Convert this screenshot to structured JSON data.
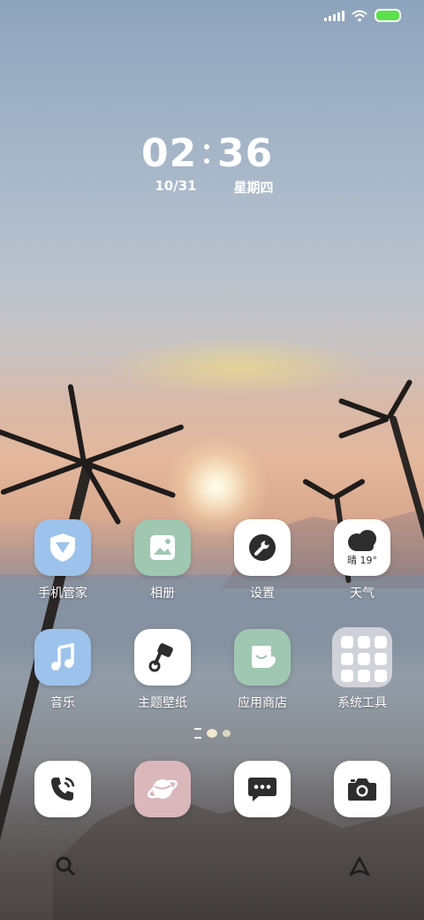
{
  "status_bar": {
    "signal_icon": "signal-icon",
    "wifi_icon": "wifi-icon",
    "battery_icon": "battery-icon",
    "battery_color": "#5ce14a"
  },
  "clock": {
    "hour": "02",
    "minute": "36",
    "date": "10/31",
    "weekday": "星期四"
  },
  "apps": [
    {
      "label": "手机管家",
      "icon": "shield-icon"
    },
    {
      "label": "相册",
      "icon": "gallery-icon"
    },
    {
      "label": "设置",
      "icon": "wrench-icon"
    },
    {
      "label": "天气",
      "icon": "weather-icon",
      "weather_text": "晴 19°"
    },
    {
      "label": "音乐",
      "icon": "music-icon"
    },
    {
      "label": "主题壁纸",
      "icon": "theme-icon"
    },
    {
      "label": "应用商店",
      "icon": "store-icon"
    },
    {
      "label": "系统工具",
      "icon": "folder-icon"
    }
  ],
  "dock": [
    {
      "icon": "phone-icon"
    },
    {
      "icon": "browser-icon"
    },
    {
      "icon": "messages-icon"
    },
    {
      "icon": "camera-icon"
    }
  ],
  "bottom": {
    "search_icon": "search-icon",
    "home_icon": "home-icon"
  }
}
